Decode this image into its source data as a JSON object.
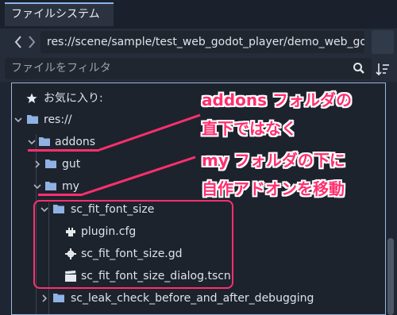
{
  "dock": {
    "tab_label": "ファイルシステム"
  },
  "nav": {
    "path": "res://scene/sample/test_web_godot_player/demo_web_godo"
  },
  "filter": {
    "placeholder": "ファイルをフィルタ"
  },
  "tree": {
    "favorites_label": "お気に入り:",
    "root_label": "res://",
    "items": [
      {
        "label": "addons"
      },
      {
        "label": "gut"
      },
      {
        "label": "my"
      },
      {
        "label": "sc_fit_font_size"
      },
      {
        "label": "plugin.cfg"
      },
      {
        "label": "sc_fit_font_size.gd"
      },
      {
        "label": "sc_fit_font_size_dialog.tscn"
      },
      {
        "label": "sc_leak_check_before_and_after_debugging"
      }
    ]
  },
  "annotation": {
    "lines": [
      "addons フォルダの",
      "直下ではなく",
      "my フォルダの下に",
      "自作アドオンを移動"
    ],
    "color": "#ff2f6f"
  }
}
